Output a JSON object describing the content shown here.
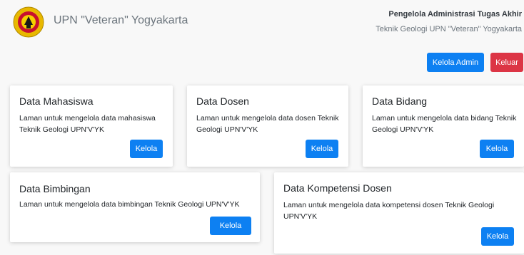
{
  "header": {
    "brand": "UPN \"Veteran\" Yogyakarta",
    "role": "Pengelola Administrasi Tugas Akhir",
    "org": "Teknik Geologi UPN \"Veteran\" Yogyakarta",
    "admin_label": "Kelola Admin",
    "logout_label": "Keluar"
  },
  "cards": [
    {
      "title": "Data Mahasiswa",
      "text": "Laman untuk mengelola data mahasiswa Teknik Geologi UPN'V'YK",
      "button": "Kelola"
    },
    {
      "title": "Data Dosen",
      "text": "Laman untuk mengelola data dosen Teknik Geologi UPN'V'YK",
      "button": "Kelola"
    },
    {
      "title": "Data Bidang",
      "text": "Laman untuk mengelola data bidang Teknik Geologi UPN'V'YK",
      "button": "Kelola"
    },
    {
      "title": "Data Bimbingan",
      "text": "Laman untuk mengelola data bimbingan Teknik Geologi UPN'V'YK",
      "button": "Kelola"
    },
    {
      "title": "Data Kompetensi Dosen",
      "text": "Laman untuk mengelola data kompetensi dosen Teknik Geologi UPN'V'YK",
      "button": "Kelola"
    }
  ],
  "colors": {
    "primary": "#0d80f2",
    "danger": "#dc3545",
    "logo_gold": "#e8b800",
    "logo_red": "#c8102e"
  }
}
